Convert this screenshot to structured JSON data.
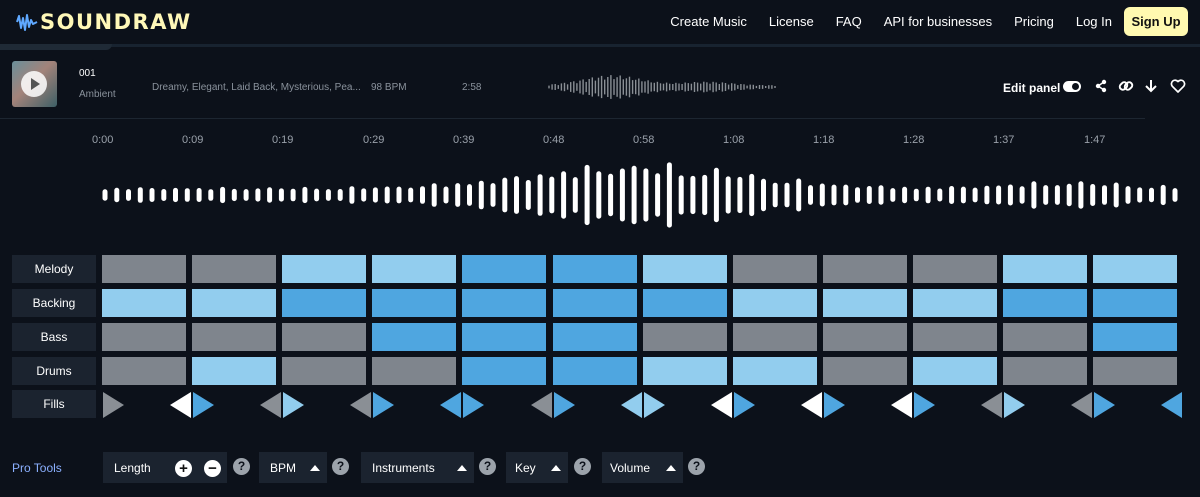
{
  "brand": {
    "name": "SOUNDRAW"
  },
  "nav": {
    "links": [
      "Create Music",
      "License",
      "FAQ",
      "API for businesses",
      "Pricing",
      "Log In"
    ],
    "signup_label": "Sign Up"
  },
  "track": {
    "number": "001",
    "genre": "Ambient",
    "tags": "Dreamy, Elegant, Laid Back, Mysterious, Pea...",
    "bpm": "98 BPM",
    "duration": "2:58",
    "edit_panel_label": "Edit panel",
    "edit_panel_on": true
  },
  "timeline": {
    "labels": [
      "0:00",
      "0:09",
      "0:19",
      "0:29",
      "0:39",
      "0:48",
      "0:58",
      "1:08",
      "1:18",
      "1:28",
      "1:37",
      "1:47"
    ]
  },
  "colors": {
    "off": "#7f858d",
    "light": "#92cdee",
    "dark": "#4fa6e0",
    "label_bg": "#1b232f",
    "fill_white": "#ffffff",
    "fill_gray": "#8a8f95",
    "fill_blue": "#4fa6e0"
  },
  "grid": {
    "rows": [
      {
        "label": "Melody",
        "cells": [
          "off",
          "off",
          "light",
          "light",
          "dark",
          "dark",
          "light",
          "off",
          "off",
          "off",
          "light",
          "light"
        ]
      },
      {
        "label": "Backing",
        "cells": [
          "light",
          "light",
          "dark",
          "dark",
          "dark",
          "dark",
          "dark",
          "light",
          "light",
          "light",
          "dark",
          "dark"
        ]
      },
      {
        "label": "Bass",
        "cells": [
          "off",
          "off",
          "off",
          "dark",
          "dark",
          "dark",
          "off",
          "off",
          "off",
          "off",
          "off",
          "dark"
        ]
      },
      {
        "label": "Drums",
        "cells": [
          "off",
          "light",
          "off",
          "off",
          "dark",
          "dark",
          "light",
          "light",
          "off",
          "light",
          "off",
          "off"
        ]
      }
    ],
    "fills": {
      "label": "Fills",
      "segments": [
        {
          "left": null,
          "right": "gray"
        },
        {
          "left": "white",
          "right": "blue"
        },
        {
          "left": "gray",
          "right": "light"
        },
        {
          "left": "gray",
          "right": "blue"
        },
        {
          "left": "blue",
          "right": "blue"
        },
        {
          "left": "gray",
          "right": "blue"
        },
        {
          "left": "light",
          "right": "light"
        },
        {
          "left": "white",
          "right": "blue"
        },
        {
          "left": "white",
          "right": "blue"
        },
        {
          "left": "white",
          "right": "blue"
        },
        {
          "left": "gray",
          "right": "light"
        },
        {
          "left": "gray",
          "right": "blue"
        },
        {
          "left": "blue",
          "right": null
        }
      ]
    }
  },
  "pro_tools": {
    "label": "Pro Tools",
    "length_label": "Length",
    "bpm_label": "BPM",
    "instruments_label": "Instruments",
    "key_label": "Key",
    "volume_label": "Volume",
    "help_glyph": "?"
  },
  "icons": {
    "share": "share-icon",
    "link": "link-icon",
    "download": "download-icon",
    "favorite": "heart-icon"
  }
}
